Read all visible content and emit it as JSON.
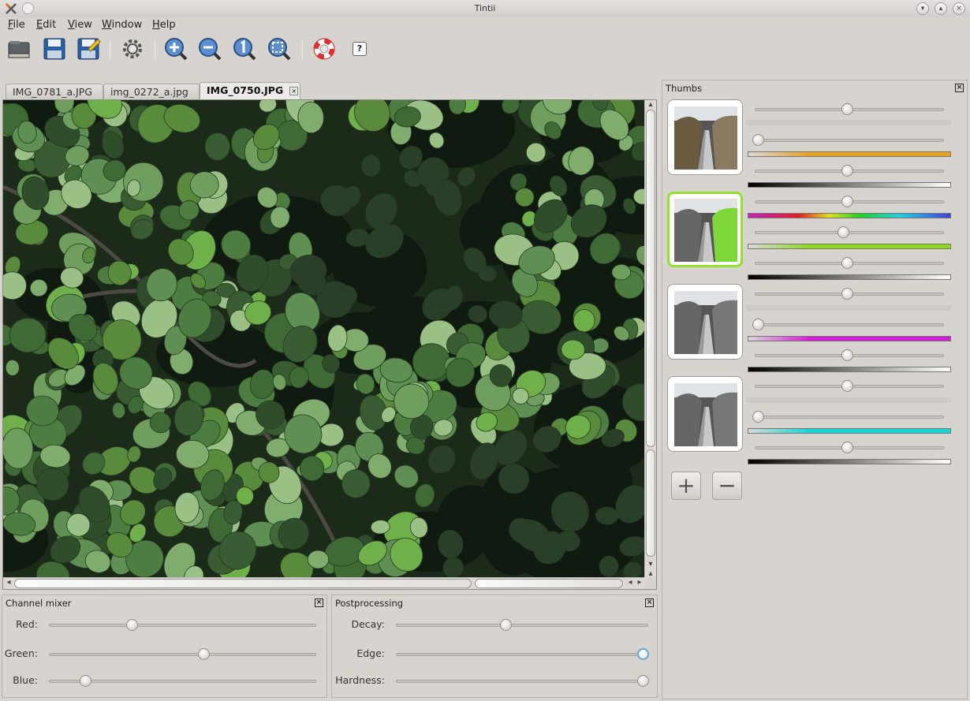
{
  "window": {
    "title": "Tintii"
  },
  "menu": [
    {
      "key": "F",
      "rest": "ile"
    },
    {
      "key": "E",
      "rest": "dit"
    },
    {
      "key": "V",
      "rest": "iew"
    },
    {
      "key": "W",
      "rest": "indow"
    },
    {
      "key": "H",
      "rest": "elp"
    }
  ],
  "toolbar": {
    "icons": [
      "open-folder-icon",
      "save-icon",
      "save-as-icon",
      "settings-gear-icon",
      "zoom-in-icon",
      "zoom-out-icon",
      "zoom-actual-size-icon",
      "zoom-fit-icon",
      "help-lifebuoy-icon",
      "whats-this-icon"
    ],
    "whats_this_label": "?"
  },
  "tabs": [
    {
      "label": "IMG_0781_a.JPG",
      "active": false
    },
    {
      "label": "img_0272_a.jpg",
      "active": false
    },
    {
      "label": "IMG_0750.JPG",
      "active": true
    }
  ],
  "tab_close_glyph": "×",
  "thumbs_panel": {
    "title": "Thumbs",
    "thumbs": [
      {
        "selected": false,
        "hue_slider": 0.5,
        "hue_bar": "#e8a020",
        "sat_slider": 0.0,
        "light_slider": 0.5
      },
      {
        "selected": true,
        "hue_slider": 0.5,
        "hue_bar": "#8cd81c",
        "sat_slider": 0.48,
        "light_slider": 0.5
      },
      {
        "selected": false,
        "hue_slider": 0.5,
        "hue_bar": "#d41cd8",
        "sat_slider": 0.0,
        "light_slider": 0.5
      },
      {
        "selected": false,
        "hue_slider": 0.5,
        "hue_bar": "#14d8d8",
        "sat_slider": 0.0,
        "light_slider": 0.5
      }
    ],
    "add_label": "+",
    "remove_label": "−"
  },
  "channel_mixer": {
    "title": "Channel mixer",
    "sliders": [
      {
        "label": "Red:",
        "value": 0.3
      },
      {
        "label": "Green:",
        "value": 0.58
      },
      {
        "label": "Blue:",
        "value": 0.12
      }
    ]
  },
  "postprocessing": {
    "title": "Postprocessing",
    "sliders": [
      {
        "label": "Decay:",
        "value": 0.43
      },
      {
        "label": "Edge:",
        "value": 1.0
      },
      {
        "label": "Hardness:",
        "value": 1.0
      }
    ]
  },
  "close_glyph": "×",
  "scroll": {
    "arrow_up": "▴",
    "arrow_down": "▾",
    "arrow_left": "◂",
    "arrow_right": "▸"
  }
}
